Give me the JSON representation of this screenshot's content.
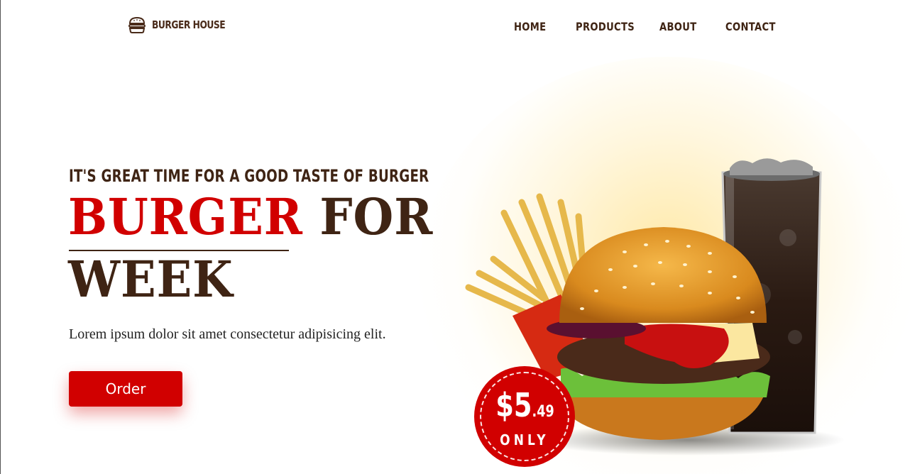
{
  "brand": {
    "name": "BURGER HOUSE",
    "logo_icon": "burger-icon"
  },
  "nav": {
    "items": [
      {
        "label": "HOME"
      },
      {
        "label": "PRODUCTS"
      },
      {
        "label": "ABOUT"
      },
      {
        "label": "CONTACT"
      }
    ]
  },
  "hero": {
    "tagline": "IT'S GREAT TIME FOR A GOOD TASTE OF BURGER",
    "headline_accent": "BURGER",
    "headline_rest": "FOR",
    "headline_line2": "WEEK",
    "lead": "Lorem ipsum dolor sit amet consectetur adipisicing elit.",
    "cta_label": "Order"
  },
  "price_badge": {
    "amount": "$5",
    "cents": ".49",
    "caption": "ONLY"
  },
  "colors": {
    "accent": "#d10000",
    "brown": "#3f2414"
  }
}
